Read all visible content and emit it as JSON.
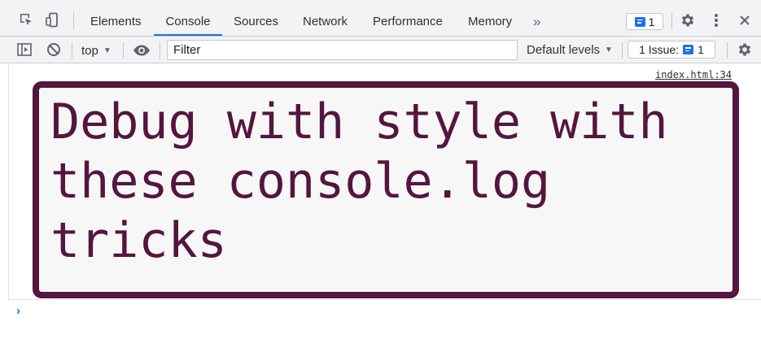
{
  "tabs": [
    {
      "label": "Elements",
      "active": false
    },
    {
      "label": "Console",
      "active": true
    },
    {
      "label": "Sources",
      "active": false
    },
    {
      "label": "Network",
      "active": false
    },
    {
      "label": "Performance",
      "active": false
    },
    {
      "label": "Memory",
      "active": false
    }
  ],
  "tabbar": {
    "more_tabs_label": "»",
    "messages_count": "1",
    "accent_color": "#1a73e8"
  },
  "toolbar": {
    "context": "top",
    "filter_placeholder": "Filter",
    "levels_label": "Default levels",
    "issues_label": "1 Issue:",
    "issues_count": "1"
  },
  "console": {
    "source_link": "index.html:34",
    "log_message": "Debug with style with\nthese console.log\ntricks",
    "log_color": "#54163e",
    "log_background": "#f7f7f7",
    "prompt_symbol": "›"
  }
}
